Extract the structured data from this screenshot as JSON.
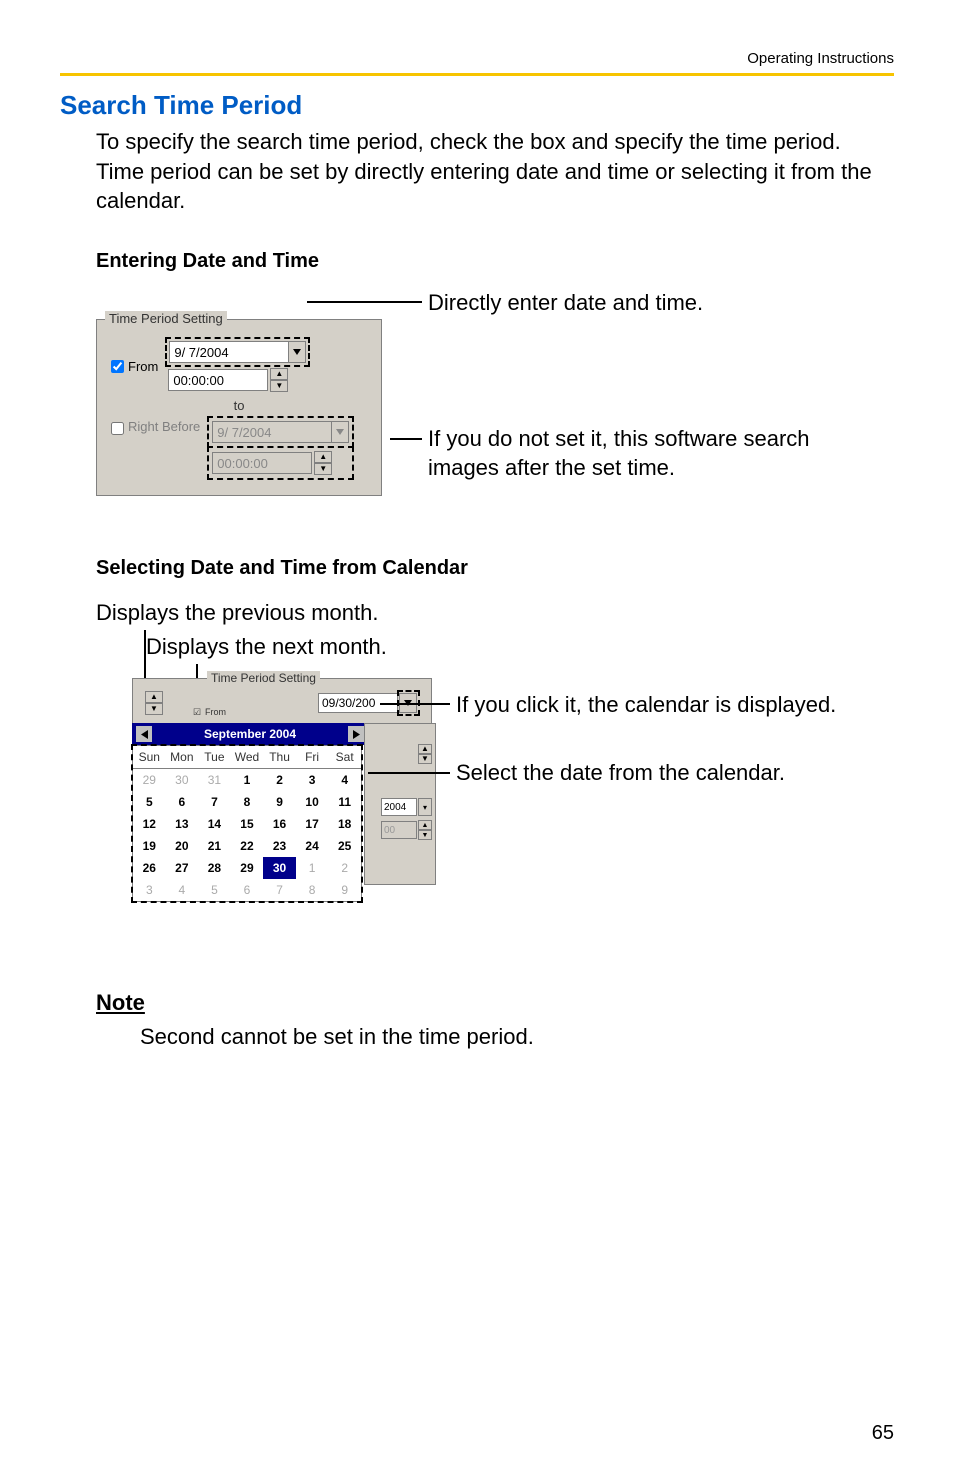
{
  "header": {
    "doc_label": "Operating Instructions"
  },
  "section": {
    "title": "Search Time Period",
    "intro": "To specify the search time period, check the box and specify the time period.\nTime period can be set by directly entering date and time or selecting it from the calendar."
  },
  "sub1": {
    "heading": "Entering Date and Time",
    "panel": {
      "legend": "Time Period Setting",
      "from_label": "From",
      "from_checked": true,
      "from_date": "9/  7/2004",
      "from_time": "00:00:00",
      "to_label": "to",
      "right_before_label": "Right Before",
      "right_before_checked": false,
      "rb_date": "9/  7/2004",
      "rb_time": "00:00:00"
    },
    "annot1": "Directly enter date and time.",
    "annot2": "If you do not set it, this software search images after the set time."
  },
  "sub2": {
    "heading": "Selecting Date and Time from Calendar",
    "caption_prev": "Displays the previous month.",
    "caption_next": "Displays the next month.",
    "top_legend": "Time Period Setting",
    "top_from_label": "From",
    "top_date_visible": "09/30/200",
    "month_label": "September 2004",
    "dows": [
      "Sun",
      "Mon",
      "Tue",
      "Wed",
      "Thu",
      "Fri",
      "Sat"
    ],
    "weeks": [
      [
        {
          "d": "29",
          "m": true
        },
        {
          "d": "30",
          "m": true
        },
        {
          "d": "31",
          "m": true
        },
        {
          "d": "1",
          "b": true
        },
        {
          "d": "2",
          "b": true
        },
        {
          "d": "3",
          "b": true
        },
        {
          "d": "4",
          "b": true
        }
      ],
      [
        {
          "d": "5",
          "b": true
        },
        {
          "d": "6",
          "b": true
        },
        {
          "d": "7",
          "b": true
        },
        {
          "d": "8",
          "b": true
        },
        {
          "d": "9",
          "b": true
        },
        {
          "d": "10",
          "b": true
        },
        {
          "d": "11",
          "b": true
        }
      ],
      [
        {
          "d": "12",
          "b": true
        },
        {
          "d": "13",
          "b": true
        },
        {
          "d": "14",
          "b": true
        },
        {
          "d": "15",
          "b": true
        },
        {
          "d": "16",
          "b": true
        },
        {
          "d": "17",
          "b": true
        },
        {
          "d": "18",
          "b": true
        }
      ],
      [
        {
          "d": "19",
          "b": true
        },
        {
          "d": "20",
          "b": true
        },
        {
          "d": "21",
          "b": true
        },
        {
          "d": "22",
          "b": true
        },
        {
          "d": "23",
          "b": true
        },
        {
          "d": "24",
          "b": true
        },
        {
          "d": "25",
          "b": true
        }
      ],
      [
        {
          "d": "26",
          "b": true
        },
        {
          "d": "27",
          "b": true
        },
        {
          "d": "28",
          "b": true
        },
        {
          "d": "29",
          "b": true
        },
        {
          "d": "30",
          "sel": true
        },
        {
          "d": "1",
          "m": true
        },
        {
          "d": "2",
          "m": true
        }
      ],
      [
        {
          "d": "3",
          "m": true
        },
        {
          "d": "4",
          "m": true
        },
        {
          "d": "5",
          "m": true
        },
        {
          "d": "6",
          "m": true
        },
        {
          "d": "7",
          "m": true
        },
        {
          "d": "8",
          "m": true
        },
        {
          "d": "9",
          "m": true
        }
      ]
    ],
    "side": {
      "r1_text": "2004",
      "r2_text": "00"
    },
    "annot_dd": "If you click it, the calendar is displayed.",
    "annot_grid": "Select the date from the calendar."
  },
  "note": {
    "heading": "Note",
    "body": "Second cannot be set in the time period."
  },
  "page_number": "65"
}
